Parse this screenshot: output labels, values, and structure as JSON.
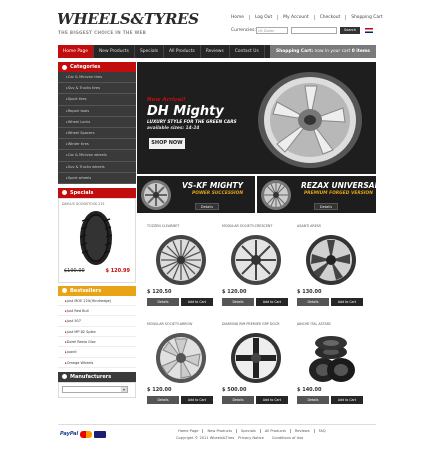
{
  "header": {
    "logo": "WHEELS&TYRES",
    "tagline": "THE BIGGEST CHOICE IN THE WEB",
    "top_links": [
      "Home",
      "Log Out",
      "My Account",
      "Checkout",
      "Shopping Cart"
    ],
    "currencies_label": "Currencies:",
    "currency_value": "US Dollar",
    "search_button": "Search"
  },
  "nav": {
    "items": [
      "Home Page",
      "New Products",
      "Specials",
      "All Products",
      "Reviews",
      "Contact Us",
      "FAQ"
    ],
    "cart_label": "Shopping Cart:",
    "cart_status": "now in your cart",
    "cart_count": "0 items"
  },
  "sidebar": {
    "categories_title": "Categories",
    "categories": [
      "Car & Minivan tires",
      "Suv & Trucks tires",
      "Sport tires",
      "Repair tools",
      "Wheel Locks",
      "Wheel Spacers",
      "Winter tires",
      "Car & Minivan wheels",
      "Suv & Trucks wheels",
      "Sport wheels"
    ],
    "specials_title": "Specials",
    "special_item": "DAYLUS GOODSTOCK 215",
    "special_old_price": "$190.00",
    "special_new_price": "$ 120.99",
    "bestsellers_title": "Bestsellers",
    "bestsellers": [
      "Just MOE 22X(Hindredge)",
      "Just Red Bull",
      "Just 507",
      "Just MP 82 Spike",
      "Dorel Resto Gloc",
      "Juanit",
      "Omega Wheels"
    ],
    "manufacturers_title": "Manufacturers"
  },
  "banner": {
    "kicker": "New Arrival!",
    "title": "DH Mighty",
    "subtitle": "LUXURY STYLE FOR THE GREEN CARS",
    "sizes": "available sizes: 14-24",
    "button": "SHOP NOW"
  },
  "promos": [
    {
      "title": "VS-KF MIGHTY",
      "subtitle": "POWER SUCCESSION",
      "button": "Details"
    },
    {
      "title": "REZAX UNIVERSAL",
      "subtitle": "PREMIUM FORGED VERSION",
      "button": "Details"
    }
  ],
  "products": [
    {
      "title": "TOZZEN CLEARMET",
      "price": "$ 120.50",
      "details": "Details",
      "add": "Add to Cart"
    },
    {
      "title": "MODULAR SOCIETY-CRESCENT",
      "price": "$ 120.00",
      "details": "Details",
      "add": "Add to Cart"
    },
    {
      "title": "ASANTI ARESS",
      "price": "$ 130.00",
      "details": "Details",
      "add": "Add to Cart"
    },
    {
      "title": "MODULAR SOCIETY-ARROW",
      "price": "$ 120.00",
      "details": "Details",
      "add": "Add to Cart"
    },
    {
      "title": "DIAMOND RIM PREMIER GRP DGCR",
      "price": "$ 500.00",
      "details": "Details",
      "add": "Add to Cart"
    },
    {
      "title": "JANCHE ITAL ASTARC",
      "price": "$ 140.00",
      "details": "Details",
      "add": "Add to Cart"
    }
  ],
  "footer": {
    "links": [
      "Home Page",
      "New Products",
      "Specials",
      "All Products",
      "Reviews",
      "FAQ"
    ],
    "copyright": "Copyright © 2011 Wheels&Tires",
    "links2": [
      "Privacy Notice",
      "Conditions of Use"
    ],
    "payments": [
      "PayPal",
      "MasterCard",
      "Visa"
    ]
  },
  "colors": {
    "accent": "#c10d0d",
    "nav": "#262626",
    "gold": "#e8a317"
  }
}
